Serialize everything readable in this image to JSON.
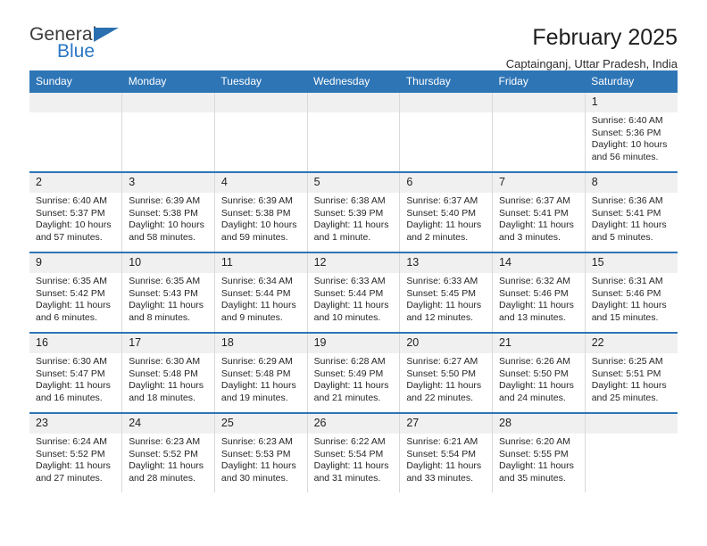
{
  "brand": {
    "name_top": "General",
    "name_bottom": "Blue",
    "triangle_color": "#2a6fb0",
    "blue_text_color": "#2a77c4"
  },
  "header": {
    "title": "February 2025",
    "subtitle": "Captainganj, Uttar Pradesh, India"
  },
  "theme": {
    "header_blue": "#2e75b6",
    "daynum_gray": "#f0f0f0",
    "grid_line": "#d9d9d9"
  },
  "weekdays": [
    "Sunday",
    "Monday",
    "Tuesday",
    "Wednesday",
    "Thursday",
    "Friday",
    "Saturday"
  ],
  "labels": {
    "sunrise_prefix": "Sunrise:",
    "sunset_prefix": "Sunset:",
    "daylight_prefix": "Daylight:"
  },
  "weeks": [
    [
      {
        "empty": true
      },
      {
        "empty": true
      },
      {
        "empty": true
      },
      {
        "empty": true
      },
      {
        "empty": true
      },
      {
        "empty": true
      },
      {
        "day": "1",
        "sunrise": "Sunrise: 6:40 AM",
        "sunset": "Sunset: 5:36 PM",
        "daylight": "Daylight: 10 hours and 56 minutes."
      }
    ],
    [
      {
        "day": "2",
        "sunrise": "Sunrise: 6:40 AM",
        "sunset": "Sunset: 5:37 PM",
        "daylight": "Daylight: 10 hours and 57 minutes."
      },
      {
        "day": "3",
        "sunrise": "Sunrise: 6:39 AM",
        "sunset": "Sunset: 5:38 PM",
        "daylight": "Daylight: 10 hours and 58 minutes."
      },
      {
        "day": "4",
        "sunrise": "Sunrise: 6:39 AM",
        "sunset": "Sunset: 5:38 PM",
        "daylight": "Daylight: 10 hours and 59 minutes."
      },
      {
        "day": "5",
        "sunrise": "Sunrise: 6:38 AM",
        "sunset": "Sunset: 5:39 PM",
        "daylight": "Daylight: 11 hours and 1 minute."
      },
      {
        "day": "6",
        "sunrise": "Sunrise: 6:37 AM",
        "sunset": "Sunset: 5:40 PM",
        "daylight": "Daylight: 11 hours and 2 minutes."
      },
      {
        "day": "7",
        "sunrise": "Sunrise: 6:37 AM",
        "sunset": "Sunset: 5:41 PM",
        "daylight": "Daylight: 11 hours and 3 minutes."
      },
      {
        "day": "8",
        "sunrise": "Sunrise: 6:36 AM",
        "sunset": "Sunset: 5:41 PM",
        "daylight": "Daylight: 11 hours and 5 minutes."
      }
    ],
    [
      {
        "day": "9",
        "sunrise": "Sunrise: 6:35 AM",
        "sunset": "Sunset: 5:42 PM",
        "daylight": "Daylight: 11 hours and 6 minutes."
      },
      {
        "day": "10",
        "sunrise": "Sunrise: 6:35 AM",
        "sunset": "Sunset: 5:43 PM",
        "daylight": "Daylight: 11 hours and 8 minutes."
      },
      {
        "day": "11",
        "sunrise": "Sunrise: 6:34 AM",
        "sunset": "Sunset: 5:44 PM",
        "daylight": "Daylight: 11 hours and 9 minutes."
      },
      {
        "day": "12",
        "sunrise": "Sunrise: 6:33 AM",
        "sunset": "Sunset: 5:44 PM",
        "daylight": "Daylight: 11 hours and 10 minutes."
      },
      {
        "day": "13",
        "sunrise": "Sunrise: 6:33 AM",
        "sunset": "Sunset: 5:45 PM",
        "daylight": "Daylight: 11 hours and 12 minutes."
      },
      {
        "day": "14",
        "sunrise": "Sunrise: 6:32 AM",
        "sunset": "Sunset: 5:46 PM",
        "daylight": "Daylight: 11 hours and 13 minutes."
      },
      {
        "day": "15",
        "sunrise": "Sunrise: 6:31 AM",
        "sunset": "Sunset: 5:46 PM",
        "daylight": "Daylight: 11 hours and 15 minutes."
      }
    ],
    [
      {
        "day": "16",
        "sunrise": "Sunrise: 6:30 AM",
        "sunset": "Sunset: 5:47 PM",
        "daylight": "Daylight: 11 hours and 16 minutes."
      },
      {
        "day": "17",
        "sunrise": "Sunrise: 6:30 AM",
        "sunset": "Sunset: 5:48 PM",
        "daylight": "Daylight: 11 hours and 18 minutes."
      },
      {
        "day": "18",
        "sunrise": "Sunrise: 6:29 AM",
        "sunset": "Sunset: 5:48 PM",
        "daylight": "Daylight: 11 hours and 19 minutes."
      },
      {
        "day": "19",
        "sunrise": "Sunrise: 6:28 AM",
        "sunset": "Sunset: 5:49 PM",
        "daylight": "Daylight: 11 hours and 21 minutes."
      },
      {
        "day": "20",
        "sunrise": "Sunrise: 6:27 AM",
        "sunset": "Sunset: 5:50 PM",
        "daylight": "Daylight: 11 hours and 22 minutes."
      },
      {
        "day": "21",
        "sunrise": "Sunrise: 6:26 AM",
        "sunset": "Sunset: 5:50 PM",
        "daylight": "Daylight: 11 hours and 24 minutes."
      },
      {
        "day": "22",
        "sunrise": "Sunrise: 6:25 AM",
        "sunset": "Sunset: 5:51 PM",
        "daylight": "Daylight: 11 hours and 25 minutes."
      }
    ],
    [
      {
        "day": "23",
        "sunrise": "Sunrise: 6:24 AM",
        "sunset": "Sunset: 5:52 PM",
        "daylight": "Daylight: 11 hours and 27 minutes."
      },
      {
        "day": "24",
        "sunrise": "Sunrise: 6:23 AM",
        "sunset": "Sunset: 5:52 PM",
        "daylight": "Daylight: 11 hours and 28 minutes."
      },
      {
        "day": "25",
        "sunrise": "Sunrise: 6:23 AM",
        "sunset": "Sunset: 5:53 PM",
        "daylight": "Daylight: 11 hours and 30 minutes."
      },
      {
        "day": "26",
        "sunrise": "Sunrise: 6:22 AM",
        "sunset": "Sunset: 5:54 PM",
        "daylight": "Daylight: 11 hours and 31 minutes."
      },
      {
        "day": "27",
        "sunrise": "Sunrise: 6:21 AM",
        "sunset": "Sunset: 5:54 PM",
        "daylight": "Daylight: 11 hours and 33 minutes."
      },
      {
        "day": "28",
        "sunrise": "Sunrise: 6:20 AM",
        "sunset": "Sunset: 5:55 PM",
        "daylight": "Daylight: 11 hours and 35 minutes."
      },
      {
        "empty": true
      }
    ]
  ]
}
